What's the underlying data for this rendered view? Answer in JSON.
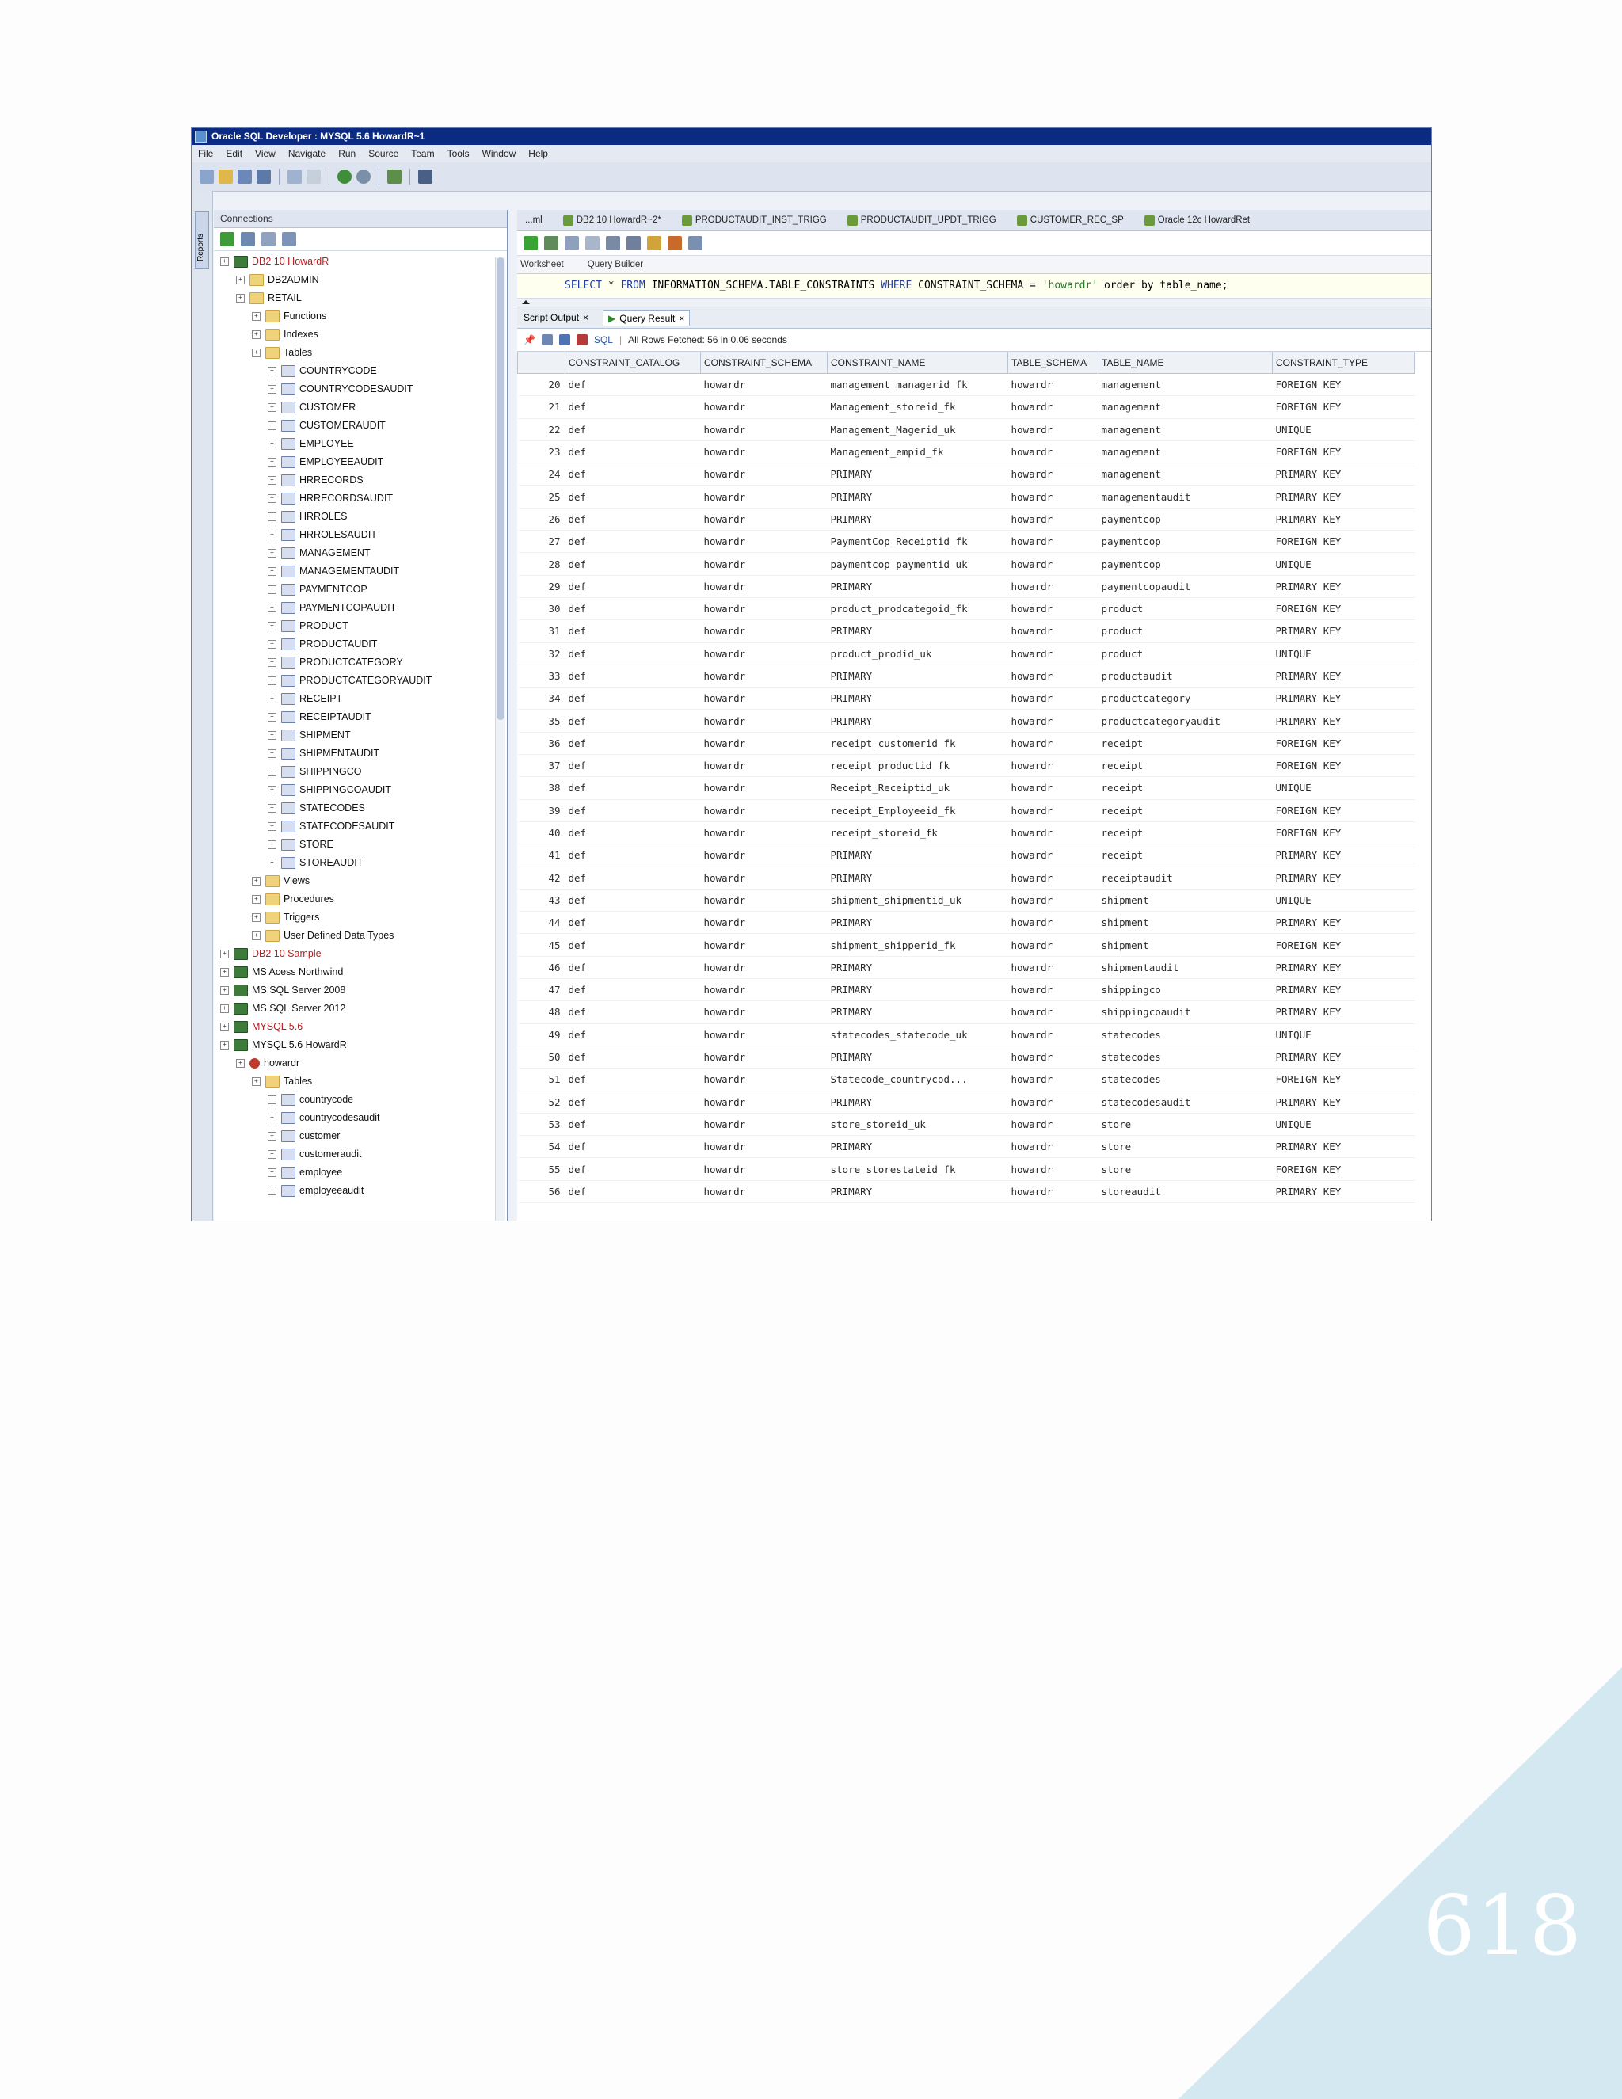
{
  "page": {
    "number": "618"
  },
  "colors": {
    "corner_triangle": "#d3e8f0",
    "title_bar": "#0b2a82",
    "red_connection": "#b51e1e"
  },
  "window": {
    "title": "Oracle SQL Developer : MYSQL 5.6 HowardR~1"
  },
  "menu": [
    "File",
    "Edit",
    "View",
    "Navigate",
    "Run",
    "Source",
    "Team",
    "Tools",
    "Window",
    "Help"
  ],
  "sidebar": {
    "vertical_tab": "Reports",
    "panel_title": "Connections",
    "tree": [
      {
        "label": "DB2 10 HowardR",
        "level": 1,
        "icon": "db",
        "red": true
      },
      {
        "label": "DB2ADMIN",
        "level": 2,
        "icon": "folder"
      },
      {
        "label": "RETAIL",
        "level": 2,
        "icon": "folder"
      },
      {
        "label": "Functions",
        "level": 3,
        "icon": "folder"
      },
      {
        "label": "Indexes",
        "level": 3,
        "icon": "folder"
      },
      {
        "label": "Tables",
        "level": 3,
        "icon": "folder"
      },
      {
        "label": "COUNTRYCODE",
        "level": 4,
        "icon": "table"
      },
      {
        "label": "COUNTRYCODESAUDIT",
        "level": 4,
        "icon": "table"
      },
      {
        "label": "CUSTOMER",
        "level": 4,
        "icon": "table"
      },
      {
        "label": "CUSTOMERAUDIT",
        "level": 4,
        "icon": "table"
      },
      {
        "label": "EMPLOYEE",
        "level": 4,
        "icon": "table"
      },
      {
        "label": "EMPLOYEEAUDIT",
        "level": 4,
        "icon": "table"
      },
      {
        "label": "HRRECORDS",
        "level": 4,
        "icon": "table"
      },
      {
        "label": "HRRECORDSAUDIT",
        "level": 4,
        "icon": "table"
      },
      {
        "label": "HRROLES",
        "level": 4,
        "icon": "table"
      },
      {
        "label": "HRROLESAUDIT",
        "level": 4,
        "icon": "table"
      },
      {
        "label": "MANAGEMENT",
        "level": 4,
        "icon": "table"
      },
      {
        "label": "MANAGEMENTAUDIT",
        "level": 4,
        "icon": "table"
      },
      {
        "label": "PAYMENTCOP",
        "level": 4,
        "icon": "table"
      },
      {
        "label": "PAYMENTCOPAUDIT",
        "level": 4,
        "icon": "table"
      },
      {
        "label": "PRODUCT",
        "level": 4,
        "icon": "table"
      },
      {
        "label": "PRODUCTAUDIT",
        "level": 4,
        "icon": "table"
      },
      {
        "label": "PRODUCTCATEGORY",
        "level": 4,
        "icon": "table"
      },
      {
        "label": "PRODUCTCATEGORYAUDIT",
        "level": 4,
        "icon": "table"
      },
      {
        "label": "RECEIPT",
        "level": 4,
        "icon": "table"
      },
      {
        "label": "RECEIPTAUDIT",
        "level": 4,
        "icon": "table"
      },
      {
        "label": "SHIPMENT",
        "level": 4,
        "icon": "table"
      },
      {
        "label": "SHIPMENTAUDIT",
        "level": 4,
        "icon": "table"
      },
      {
        "label": "SHIPPINGCO",
        "level": 4,
        "icon": "table"
      },
      {
        "label": "SHIPPINGCOAUDIT",
        "level": 4,
        "icon": "table"
      },
      {
        "label": "STATECODES",
        "level": 4,
        "icon": "table"
      },
      {
        "label": "STATECODESAUDIT",
        "level": 4,
        "icon": "table"
      },
      {
        "label": "STORE",
        "level": 4,
        "icon": "table"
      },
      {
        "label": "STOREAUDIT",
        "level": 4,
        "icon": "table"
      },
      {
        "label": "Views",
        "level": 3,
        "icon": "folder"
      },
      {
        "label": "Procedures",
        "level": 3,
        "icon": "folder"
      },
      {
        "label": "Triggers",
        "level": 3,
        "icon": "folder"
      },
      {
        "label": "User Defined Data Types",
        "level": 3,
        "icon": "folder"
      },
      {
        "label": "DB2 10 Sample",
        "level": 1,
        "icon": "db",
        "red": true
      },
      {
        "label": "MS Acess Northwind",
        "level": 1,
        "icon": "db"
      },
      {
        "label": "MS SQL Server 2008",
        "level": 1,
        "icon": "db"
      },
      {
        "label": "MS SQL Server 2012",
        "level": 1,
        "icon": "db"
      },
      {
        "label": "MYSQL 5.6",
        "level": 1,
        "icon": "db",
        "red": true
      },
      {
        "label": "MYSQL 5.6 HowardR",
        "level": 1,
        "icon": "db"
      },
      {
        "label": "howardr",
        "level": 2,
        "icon": "user"
      },
      {
        "label": "Tables",
        "level": 3,
        "icon": "folder"
      },
      {
        "label": "countrycode",
        "level": 4,
        "icon": "table"
      },
      {
        "label": "countrycodesaudit",
        "level": 4,
        "icon": "table"
      },
      {
        "label": "customer",
        "level": 4,
        "icon": "table"
      },
      {
        "label": "customeraudit",
        "level": 4,
        "icon": "table"
      },
      {
        "label": "employee",
        "level": 4,
        "icon": "table"
      },
      {
        "label": "employeeaudit",
        "level": 4,
        "icon": "table"
      }
    ]
  },
  "editor": {
    "tabs": [
      "...ml",
      "DB2 10 HowardR~2*",
      "PRODUCTAUDIT_INST_TRIGG",
      "PRODUCTAUDIT_UPDT_TRIGG",
      "CUSTOMER_REC_SP",
      "Oracle 12c HowardRet"
    ],
    "subtabs": [
      "Worksheet",
      "Query Builder"
    ],
    "sql": {
      "select": "SELECT",
      "star": " * ",
      "from": "FROM",
      "table": " INFORMATION_SCHEMA.TABLE_CONSTRAINTS ",
      "where": "WHERE",
      "cond": " CONSTRAINT_SCHEMA = ",
      "literal": "'howardr'",
      "tail": " order by table_name;"
    }
  },
  "results": {
    "tabs": [
      "Script Output",
      "Query Result"
    ],
    "sql_label": "SQL",
    "status": "All Rows Fetched: 56 in 0.06 seconds",
    "columns": [
      "CONSTRAINT_CATALOG",
      "CONSTRAINT_SCHEMA",
      "CONSTRAINT_NAME",
      "TABLE_SCHEMA",
      "TABLE_NAME",
      "CONSTRAINT_TYPE"
    ],
    "rows": [
      [
        "20",
        "def",
        "howardr",
        "management_managerid_fk",
        "howardr",
        "management",
        "FOREIGN KEY"
      ],
      [
        "21",
        "def",
        "howardr",
        "Management_storeid_fk",
        "howardr",
        "management",
        "FOREIGN KEY"
      ],
      [
        "22",
        "def",
        "howardr",
        "Management_Magerid_uk",
        "howardr",
        "management",
        "UNIQUE"
      ],
      [
        "23",
        "def",
        "howardr",
        "Management_empid_fk",
        "howardr",
        "management",
        "FOREIGN KEY"
      ],
      [
        "24",
        "def",
        "howardr",
        "PRIMARY",
        "howardr",
        "management",
        "PRIMARY KEY"
      ],
      [
        "25",
        "def",
        "howardr",
        "PRIMARY",
        "howardr",
        "managementaudit",
        "PRIMARY KEY"
      ],
      [
        "26",
        "def",
        "howardr",
        "PRIMARY",
        "howardr",
        "paymentcop",
        "PRIMARY KEY"
      ],
      [
        "27",
        "def",
        "howardr",
        "PaymentCop_Receiptid_fk",
        "howardr",
        "paymentcop",
        "FOREIGN KEY"
      ],
      [
        "28",
        "def",
        "howardr",
        "paymentcop_paymentid_uk",
        "howardr",
        "paymentcop",
        "UNIQUE"
      ],
      [
        "29",
        "def",
        "howardr",
        "PRIMARY",
        "howardr",
        "paymentcopaudit",
        "PRIMARY KEY"
      ],
      [
        "30",
        "def",
        "howardr",
        "product_prodcategoid_fk",
        "howardr",
        "product",
        "FOREIGN KEY"
      ],
      [
        "31",
        "def",
        "howardr",
        "PRIMARY",
        "howardr",
        "product",
        "PRIMARY KEY"
      ],
      [
        "32",
        "def",
        "howardr",
        "product_prodid_uk",
        "howardr",
        "product",
        "UNIQUE"
      ],
      [
        "33",
        "def",
        "howardr",
        "PRIMARY",
        "howardr",
        "productaudit",
        "PRIMARY KEY"
      ],
      [
        "34",
        "def",
        "howardr",
        "PRIMARY",
        "howardr",
        "productcategory",
        "PRIMARY KEY"
      ],
      [
        "35",
        "def",
        "howardr",
        "PRIMARY",
        "howardr",
        "productcategoryaudit",
        "PRIMARY KEY"
      ],
      [
        "36",
        "def",
        "howardr",
        "receipt_customerid_fk",
        "howardr",
        "receipt",
        "FOREIGN KEY"
      ],
      [
        "37",
        "def",
        "howardr",
        "receipt_productid_fk",
        "howardr",
        "receipt",
        "FOREIGN KEY"
      ],
      [
        "38",
        "def",
        "howardr",
        "Receipt_Receiptid_uk",
        "howardr",
        "receipt",
        "UNIQUE"
      ],
      [
        "39",
        "def",
        "howardr",
        "receipt_Employeeid_fk",
        "howardr",
        "receipt",
        "FOREIGN KEY"
      ],
      [
        "40",
        "def",
        "howardr",
        "receipt_storeid_fk",
        "howardr",
        "receipt",
        "FOREIGN KEY"
      ],
      [
        "41",
        "def",
        "howardr",
        "PRIMARY",
        "howardr",
        "receipt",
        "PRIMARY KEY"
      ],
      [
        "42",
        "def",
        "howardr",
        "PRIMARY",
        "howardr",
        "receiptaudit",
        "PRIMARY KEY"
      ],
      [
        "43",
        "def",
        "howardr",
        "shipment_shipmentid_uk",
        "howardr",
        "shipment",
        "UNIQUE"
      ],
      [
        "44",
        "def",
        "howardr",
        "PRIMARY",
        "howardr",
        "shipment",
        "PRIMARY KEY"
      ],
      [
        "45",
        "def",
        "howardr",
        "shipment_shipperid_fk",
        "howardr",
        "shipment",
        "FOREIGN KEY"
      ],
      [
        "46",
        "def",
        "howardr",
        "PRIMARY",
        "howardr",
        "shipmentaudit",
        "PRIMARY KEY"
      ],
      [
        "47",
        "def",
        "howardr",
        "PRIMARY",
        "howardr",
        "shippingco",
        "PRIMARY KEY"
      ],
      [
        "48",
        "def",
        "howardr",
        "PRIMARY",
        "howardr",
        "shippingcoaudit",
        "PRIMARY KEY"
      ],
      [
        "49",
        "def",
        "howardr",
        "statecodes_statecode_uk",
        "howardr",
        "statecodes",
        "UNIQUE"
      ],
      [
        "50",
        "def",
        "howardr",
        "PRIMARY",
        "howardr",
        "statecodes",
        "PRIMARY KEY"
      ],
      [
        "51",
        "def",
        "howardr",
        "Statecode_countrycod...",
        "howardr",
        "statecodes",
        "FOREIGN KEY"
      ],
      [
        "52",
        "def",
        "howardr",
        "PRIMARY",
        "howardr",
        "statecodesaudit",
        "PRIMARY KEY"
      ],
      [
        "53",
        "def",
        "howardr",
        "store_storeid_uk",
        "howardr",
        "store",
        "UNIQUE"
      ],
      [
        "54",
        "def",
        "howardr",
        "PRIMARY",
        "howardr",
        "store",
        "PRIMARY KEY"
      ],
      [
        "55",
        "def",
        "howardr",
        "store_storestateid_fk",
        "howardr",
        "store",
        "FOREIGN KEY"
      ],
      [
        "56",
        "def",
        "howardr",
        "PRIMARY",
        "howardr",
        "storeaudit",
        "PRIMARY KEY"
      ]
    ]
  }
}
